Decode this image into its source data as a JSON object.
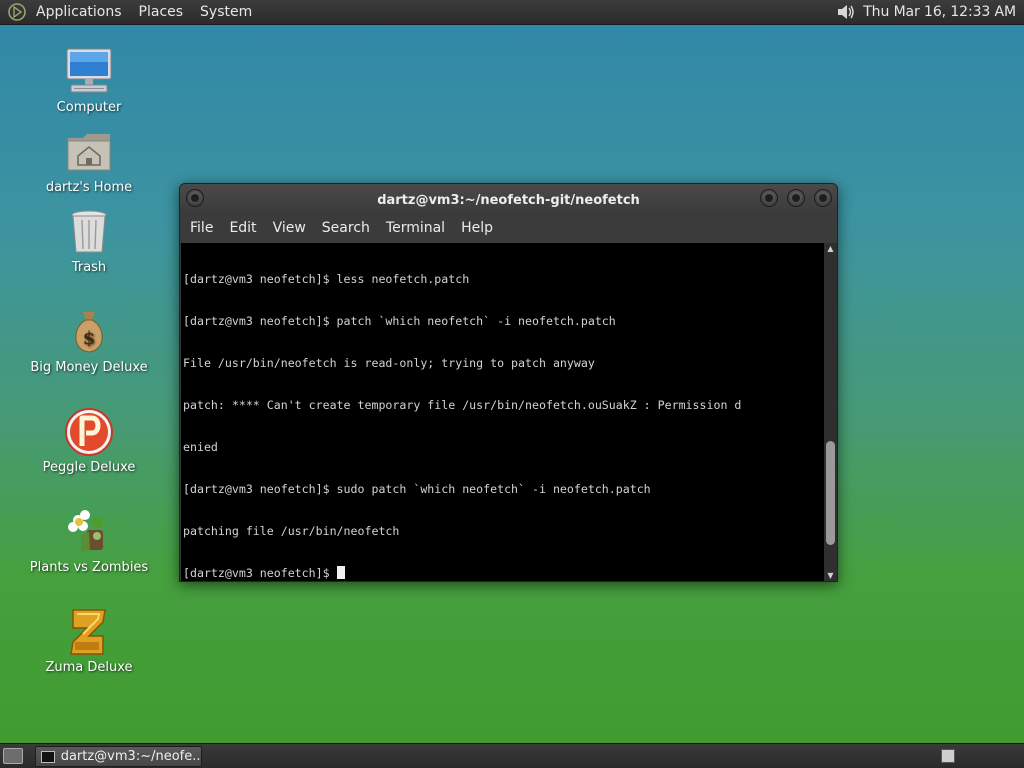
{
  "top_panel": {
    "menus": [
      "Applications",
      "Places",
      "System"
    ],
    "clock": "Thu Mar 16, 12:33 AM"
  },
  "desktop_icons": [
    {
      "label": "Computer",
      "icon": "computer-icon"
    },
    {
      "label": "dartz's Home",
      "icon": "home-folder-icon"
    },
    {
      "label": "Trash",
      "icon": "trash-icon"
    },
    {
      "label": "Big Money Deluxe",
      "icon": "money-bag-icon"
    },
    {
      "label": "Peggle Deluxe",
      "icon": "peggle-icon"
    },
    {
      "label": "Plants vs Zombies",
      "icon": "plants-vs-zombies-icon"
    },
    {
      "label": "Zuma Deluxe",
      "icon": "zuma-icon"
    }
  ],
  "terminal": {
    "title": "dartz@vm3:~/neofetch-git/neofetch",
    "menu": [
      "File",
      "Edit",
      "View",
      "Search",
      "Terminal",
      "Help"
    ],
    "lines": [
      "[dartz@vm3 neofetch]$ less neofetch.patch",
      "[dartz@vm3 neofetch]$ patch `which neofetch` -i neofetch.patch",
      "File /usr/bin/neofetch is read-only; trying to patch anyway",
      "patch: **** Can't create temporary file /usr/bin/neofetch.ouSuakZ : Permission d",
      "enied",
      "[dartz@vm3 neofetch]$ sudo patch `which neofetch` -i neofetch.patch",
      "patching file /usr/bin/neofetch"
    ],
    "prompt": "[dartz@vm3 neofetch]$ ",
    "scroll_position": 0.88
  },
  "bottom_panel": {
    "task_label": "dartz@vm3:~/neofe..."
  },
  "colors": {
    "panel": "#2f2f2f",
    "terminal_bg": "#000000",
    "terminal_fg": "#d3d3d3",
    "desktop_top": "#2f86a8",
    "desktop_bottom": "#3f9b2e"
  }
}
